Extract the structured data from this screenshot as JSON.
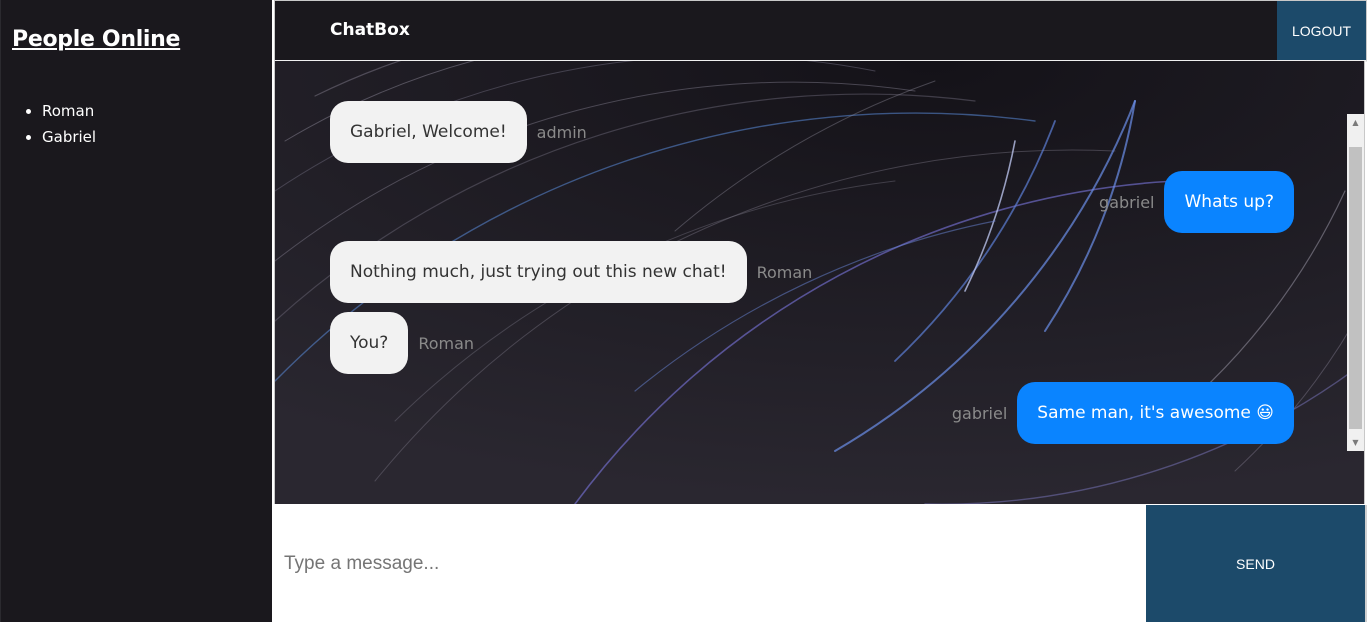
{
  "sidebar": {
    "title": "People Online",
    "people": [
      "Roman",
      "Gabriel"
    ]
  },
  "header": {
    "brand": "ChatBox",
    "logout_label": "LOGOUT"
  },
  "messages": [
    {
      "text": "Gabriel, Welcome!",
      "sender": "admin",
      "direction": "incoming"
    },
    {
      "text": "Whats up?",
      "sender": "gabriel",
      "direction": "outgoing"
    },
    {
      "text": "Nothing much, just trying out this new chat!",
      "sender": "Roman",
      "direction": "incoming"
    },
    {
      "text": "You?",
      "sender": "Roman",
      "direction": "incoming"
    },
    {
      "text": "Same man, it's awesome 😃",
      "sender": "gabriel",
      "direction": "outgoing"
    }
  ],
  "composer": {
    "placeholder": "Type a message...",
    "send_label": "SEND"
  },
  "colors": {
    "dark_bg": "#1a181d",
    "accent": "#1c4a6a",
    "outgoing_bubble": "#0a84ff",
    "incoming_bubble": "#f2f2f2"
  }
}
